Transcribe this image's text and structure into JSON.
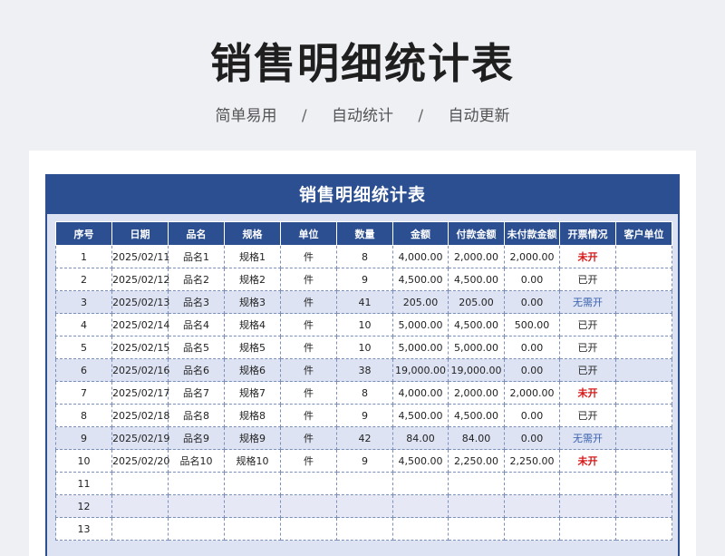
{
  "hero": {
    "title": "销售明细统计表",
    "tags": [
      "简单易用",
      "自动统计",
      "自动更新"
    ],
    "separator": "/"
  },
  "sheet": {
    "title": "销售明细统计表",
    "columns": [
      "序号",
      "日期",
      "品名",
      "规格",
      "单位",
      "数量",
      "金额",
      "付款金额",
      "未付款金额",
      "开票情况",
      "客户单位"
    ],
    "rows": [
      [
        "1",
        "2025/02/11",
        "品名1",
        "规格1",
        "件",
        "8",
        "4,000.00",
        "2,000.00",
        "2,000.00",
        "未开",
        ""
      ],
      [
        "2",
        "2025/02/12",
        "品名2",
        "规格2",
        "件",
        "9",
        "4,500.00",
        "4,500.00",
        "0.00",
        "已开",
        ""
      ],
      [
        "3",
        "2025/02/13",
        "品名3",
        "规格3",
        "件",
        "41",
        "205.00",
        "205.00",
        "0.00",
        "无需开",
        ""
      ],
      [
        "4",
        "2025/02/14",
        "品名4",
        "规格4",
        "件",
        "10",
        "5,000.00",
        "4,500.00",
        "500.00",
        "已开",
        ""
      ],
      [
        "5",
        "2025/02/15",
        "品名5",
        "规格5",
        "件",
        "10",
        "5,000.00",
        "5,000.00",
        "0.00",
        "已开",
        ""
      ],
      [
        "6",
        "2025/02/16",
        "品名6",
        "规格6",
        "件",
        "38",
        "19,000.00",
        "19,000.00",
        "0.00",
        "已开",
        ""
      ],
      [
        "7",
        "2025/02/17",
        "品名7",
        "规格7",
        "件",
        "8",
        "4,000.00",
        "2,000.00",
        "2,000.00",
        "未开",
        ""
      ],
      [
        "8",
        "2025/02/18",
        "品名8",
        "规格8",
        "件",
        "9",
        "4,500.00",
        "4,500.00",
        "0.00",
        "已开",
        ""
      ],
      [
        "9",
        "2025/02/19",
        "品名9",
        "规格9",
        "件",
        "42",
        "84.00",
        "84.00",
        "0.00",
        "无需开",
        ""
      ],
      [
        "10",
        "2025/02/20",
        "品名10",
        "规格10",
        "件",
        "9",
        "4,500.00",
        "2,250.00",
        "2,250.00",
        "未开",
        ""
      ],
      [
        "11",
        "",
        "",
        "",
        "",
        "",
        "",
        "",
        "",
        "",
        ""
      ],
      [
        "12",
        "",
        "",
        "",
        "",
        "",
        "",
        "",
        "",
        "",
        ""
      ],
      [
        "13",
        "",
        "",
        "",
        "",
        "",
        "",
        "",
        "",
        "",
        ""
      ]
    ],
    "status_colors": {
      "未开": "#d71a1a",
      "无需开": "#3a60b0",
      "已开": "#222222"
    },
    "colors": {
      "header_bg": "#2b4f91",
      "stripe_bg": "#dde3f2"
    }
  }
}
